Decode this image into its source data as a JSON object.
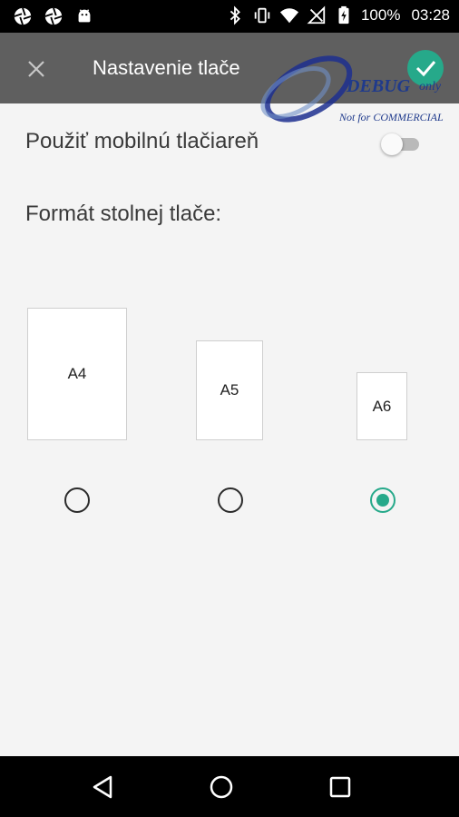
{
  "status_bar": {
    "left_icons": [
      "aperture-icon",
      "aperture-icon",
      "android-icon"
    ],
    "right_icons": [
      "bluetooth-icon",
      "vibrate-icon",
      "wifi-icon",
      "no-signal-icon",
      "battery-charging-icon"
    ],
    "battery_percent": "100%",
    "time": "03:28"
  },
  "toolbar": {
    "close_icon": "close-icon",
    "title": "Nastavenie tlače",
    "confirm_icon": "check-icon",
    "accent_color": "#26a98a",
    "background_color": "#5f5f5f"
  },
  "watermark": {
    "debug": "DEBUG",
    "only": "only",
    "not_for": "Not for COMMERCIAL"
  },
  "settings": {
    "mobile_printer_label": "Použiť mobilnú tlačiareň",
    "mobile_printer_enabled": false,
    "format_label": "Formát stolnej tlače:",
    "formats": [
      {
        "label": "A4",
        "selected": false
      },
      {
        "label": "A5",
        "selected": false
      },
      {
        "label": "A6",
        "selected": true
      }
    ]
  },
  "nav_bar": {
    "icons": [
      "back-icon",
      "home-icon",
      "recent-apps-icon"
    ]
  }
}
